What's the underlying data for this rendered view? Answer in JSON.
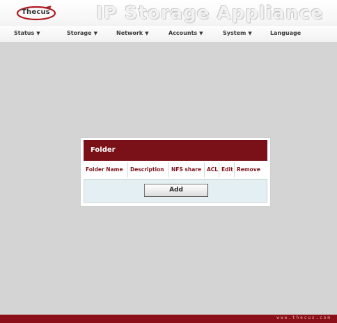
{
  "app": {
    "title": "IP Storage Appliance",
    "logo_text": "Thecus"
  },
  "nav": {
    "items": [
      {
        "label": "Status",
        "has_dropdown": true
      },
      {
        "label": "Storage",
        "has_dropdown": true
      },
      {
        "label": "Network",
        "has_dropdown": true
      },
      {
        "label": "Accounts",
        "has_dropdown": true
      },
      {
        "label": "System",
        "has_dropdown": true
      },
      {
        "label": "Language",
        "has_dropdown": false
      }
    ]
  },
  "folder_panel": {
    "title": "Folder",
    "columns": [
      "Folder Name",
      "Description",
      "NFS share",
      "ACL",
      "Edit",
      "Remove"
    ],
    "add_label": "Add"
  },
  "footer": {
    "url": "www.thecus.com"
  },
  "colors": {
    "accent": "#7b1118",
    "footer": "#8a0f18",
    "background": "#d4d4d4"
  }
}
